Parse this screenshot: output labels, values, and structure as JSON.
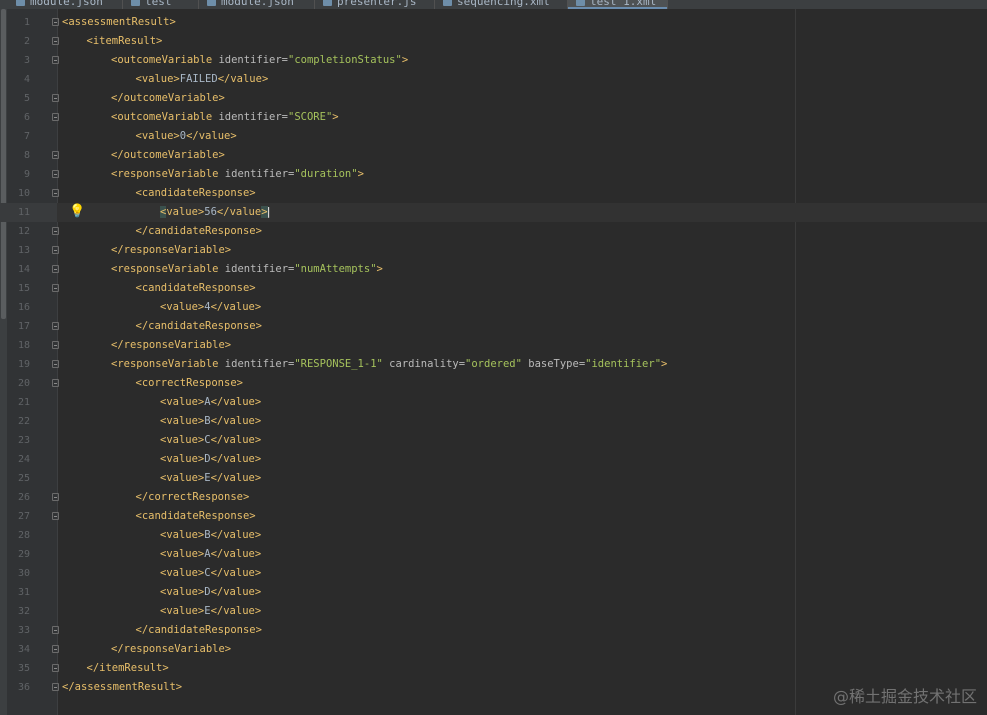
{
  "tabs": [
    {
      "label": "module.json"
    },
    {
      "label": "test"
    },
    {
      "label": "module.json"
    },
    {
      "label": "presenter.js"
    },
    {
      "label": "sequencing.xml"
    },
    {
      "label": "test_1.xml",
      "active": true
    }
  ],
  "editor": {
    "caret_line": 11,
    "lines": [
      {
        "n": "1",
        "tok": [
          {
            "c": "tag",
            "t": "<assessmentResult>"
          }
        ]
      },
      {
        "n": "2",
        "tok": [
          {
            "c": "tag",
            "t": "<itemResult>"
          }
        ]
      },
      {
        "n": "3",
        "tok": [
          {
            "c": "tag",
            "t": "<outcomeVariable "
          },
          {
            "c": "attr",
            "t": "identifier="
          },
          {
            "c": "val",
            "t": "\"completionStatus\""
          },
          {
            "c": "tag",
            "t": ">"
          }
        ]
      },
      {
        "n": "4",
        "tok": [
          {
            "c": "tag",
            "t": "<value>"
          },
          {
            "c": "txt",
            "t": "FAILED"
          },
          {
            "c": "tag",
            "t": "</value>"
          }
        ]
      },
      {
        "n": "5",
        "tok": [
          {
            "c": "tag",
            "t": "</outcomeVariable>"
          }
        ]
      },
      {
        "n": "6",
        "tok": [
          {
            "c": "tag",
            "t": "<outcomeVariable "
          },
          {
            "c": "attr",
            "t": "identifier="
          },
          {
            "c": "val",
            "t": "\"SCORE\""
          },
          {
            "c": "tag",
            "t": ">"
          }
        ]
      },
      {
        "n": "7",
        "tok": [
          {
            "c": "tag",
            "t": "<value>"
          },
          {
            "c": "txt",
            "t": "0"
          },
          {
            "c": "tag",
            "t": "</value>"
          }
        ]
      },
      {
        "n": "8",
        "tok": [
          {
            "c": "tag",
            "t": "</outcomeVariable>"
          }
        ]
      },
      {
        "n": "9",
        "tok": [
          {
            "c": "tag",
            "t": "<responseVariable "
          },
          {
            "c": "attr",
            "t": "identifier="
          },
          {
            "c": "val",
            "t": "\"duration\""
          },
          {
            "c": "tag",
            "t": ">"
          }
        ]
      },
      {
        "n": "10",
        "tok": [
          {
            "c": "tag",
            "t": "<candidateResponse>"
          }
        ]
      },
      {
        "n": "11",
        "tok": [
          {
            "c": "tag hl",
            "t": "<"
          },
          {
            "c": "tag",
            "t": "value>"
          },
          {
            "c": "txt",
            "t": "56"
          },
          {
            "c": "tag",
            "t": "</value"
          },
          {
            "c": "tag hl",
            "t": ">"
          }
        ]
      },
      {
        "n": "12",
        "tok": [
          {
            "c": "tag",
            "t": "</candidateResponse>"
          }
        ]
      },
      {
        "n": "13",
        "tok": [
          {
            "c": "tag",
            "t": "</responseVariable>"
          }
        ]
      },
      {
        "n": "14",
        "tok": [
          {
            "c": "tag",
            "t": "<responseVariable "
          },
          {
            "c": "attr",
            "t": "identifier="
          },
          {
            "c": "val",
            "t": "\"numAttempts\""
          },
          {
            "c": "tag",
            "t": ">"
          }
        ]
      },
      {
        "n": "15",
        "tok": [
          {
            "c": "tag",
            "t": "<candidateResponse>"
          }
        ]
      },
      {
        "n": "16",
        "tok": [
          {
            "c": "tag",
            "t": "<value>"
          },
          {
            "c": "txt",
            "t": "4"
          },
          {
            "c": "tag",
            "t": "</value>"
          }
        ]
      },
      {
        "n": "17",
        "tok": [
          {
            "c": "tag",
            "t": "</candidateResponse>"
          }
        ]
      },
      {
        "n": "18",
        "tok": [
          {
            "c": "tag",
            "t": "</responseVariable>"
          }
        ]
      },
      {
        "n": "19",
        "tok": [
          {
            "c": "tag",
            "t": "<responseVariable "
          },
          {
            "c": "attr",
            "t": "identifier="
          },
          {
            "c": "val",
            "t": "\"RESPONSE_1-1\" "
          },
          {
            "c": "attr",
            "t": "cardinality="
          },
          {
            "c": "val",
            "t": "\"ordered\" "
          },
          {
            "c": "attr",
            "t": "baseType="
          },
          {
            "c": "val",
            "t": "\"identifier\""
          },
          {
            "c": "tag",
            "t": ">"
          }
        ]
      },
      {
        "n": "20",
        "tok": [
          {
            "c": "tag",
            "t": "<correctResponse>"
          }
        ]
      },
      {
        "n": "21",
        "tok": [
          {
            "c": "tag",
            "t": "<value>"
          },
          {
            "c": "txt",
            "t": "A"
          },
          {
            "c": "tag",
            "t": "</value>"
          }
        ]
      },
      {
        "n": "22",
        "tok": [
          {
            "c": "tag",
            "t": "<value>"
          },
          {
            "c": "txt",
            "t": "B"
          },
          {
            "c": "tag",
            "t": "</value>"
          }
        ]
      },
      {
        "n": "23",
        "tok": [
          {
            "c": "tag",
            "t": "<value>"
          },
          {
            "c": "txt",
            "t": "C"
          },
          {
            "c": "tag",
            "t": "</value>"
          }
        ]
      },
      {
        "n": "24",
        "tok": [
          {
            "c": "tag",
            "t": "<value>"
          },
          {
            "c": "txt",
            "t": "D"
          },
          {
            "c": "tag",
            "t": "</value>"
          }
        ]
      },
      {
        "n": "25",
        "tok": [
          {
            "c": "tag",
            "t": "<value>"
          },
          {
            "c": "txt",
            "t": "E"
          },
          {
            "c": "tag",
            "t": "</value>"
          }
        ]
      },
      {
        "n": "26",
        "tok": [
          {
            "c": "tag",
            "t": "</correctResponse>"
          }
        ]
      },
      {
        "n": "27",
        "tok": [
          {
            "c": "tag",
            "t": "<candidateResponse>"
          }
        ]
      },
      {
        "n": "28",
        "tok": [
          {
            "c": "tag",
            "t": "<value>"
          },
          {
            "c": "txt",
            "t": "B"
          },
          {
            "c": "tag",
            "t": "</value>"
          }
        ]
      },
      {
        "n": "29",
        "tok": [
          {
            "c": "tag",
            "t": "<value>"
          },
          {
            "c": "txt",
            "t": "A"
          },
          {
            "c": "tag",
            "t": "</value>"
          }
        ]
      },
      {
        "n": "30",
        "tok": [
          {
            "c": "tag",
            "t": "<value>"
          },
          {
            "c": "txt",
            "t": "C"
          },
          {
            "c": "tag",
            "t": "</value>"
          }
        ]
      },
      {
        "n": "31",
        "tok": [
          {
            "c": "tag",
            "t": "<value>"
          },
          {
            "c": "txt",
            "t": "D"
          },
          {
            "c": "tag",
            "t": "</value>"
          }
        ]
      },
      {
        "n": "32",
        "tok": [
          {
            "c": "tag",
            "t": "<value>"
          },
          {
            "c": "txt",
            "t": "E"
          },
          {
            "c": "tag",
            "t": "</value>"
          }
        ]
      },
      {
        "n": "33",
        "tok": [
          {
            "c": "tag",
            "t": "</candidateResponse>"
          }
        ]
      },
      {
        "n": "34",
        "tok": [
          {
            "c": "tag",
            "t": "</responseVariable>"
          }
        ]
      },
      {
        "n": "35",
        "tok": [
          {
            "c": "tag",
            "t": "</itemResult>"
          }
        ]
      },
      {
        "n": "36",
        "tok": [
          {
            "c": "tag",
            "t": "</assessmentResult>"
          }
        ]
      }
    ]
  },
  "watermark": "@稀土掘金技术社区",
  "colors": {
    "background": "#2b2b2b",
    "gutter": "#313335",
    "tag": "#e8bf6a",
    "attribute": "#bababa",
    "attribute_value": "#a5c25c",
    "text": "#a9b7c6",
    "line_number": "#606366",
    "bulb": "#e6c229"
  }
}
